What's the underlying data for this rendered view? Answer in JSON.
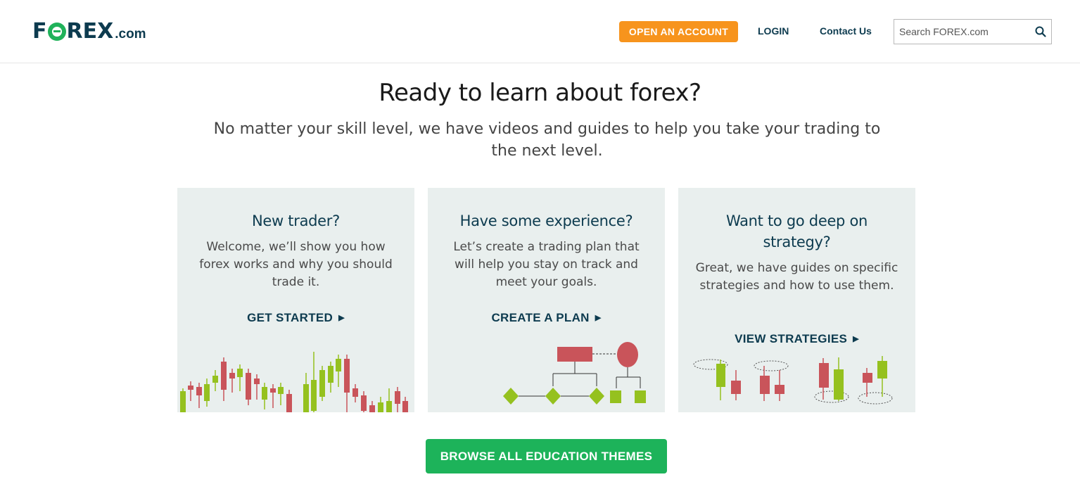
{
  "header": {
    "logo": {
      "left_text": "F",
      "right_text": "REX",
      "suffix": ".com"
    },
    "open_account_label": "OPEN AN ACCOUNT",
    "login_label": "LOGIN",
    "contact_label": "Contact Us",
    "search": {
      "placeholder": "Search FOREX.com",
      "value": "",
      "icon": "search-icon"
    }
  },
  "hero": {
    "title": "Ready to learn about forex?",
    "subtitle": "No matter your skill level, we have videos and guides to help you take your trading to the next level."
  },
  "cards": [
    {
      "title": "New trader?",
      "text": "Welcome, we’ll show you how forex works and why you should trade it.",
      "link": "GET STARTED",
      "illustration": "candlestick-chart"
    },
    {
      "title": "Have some experience?",
      "text": "Let’s create a trading plan that will help you stay on track and meet your goals.",
      "link": "CREATE A PLAN",
      "illustration": "flowchart"
    },
    {
      "title": "Want to go deep on strategy?",
      "text": "Great, we have guides on specific strategies and how to use them.",
      "link": "VIEW STRATEGIES",
      "illustration": "candlestick-patterns"
    }
  ],
  "browse_label": "BROWSE ALL EDUCATION THEMES",
  "colors": {
    "navy": "#0d3b4f",
    "orange": "#f7941d",
    "green": "#1db35a",
    "card_bg": "#e9efee",
    "candle_red": "#c9545a",
    "candle_green": "#95c11f"
  }
}
